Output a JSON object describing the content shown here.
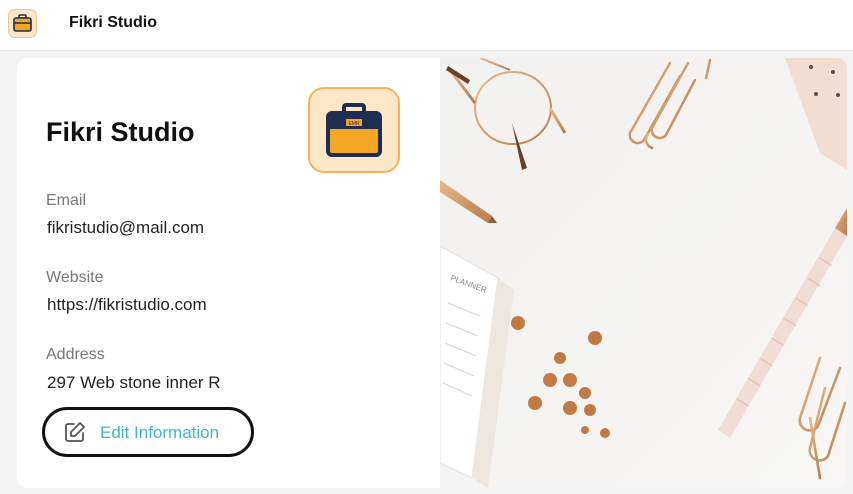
{
  "app": {
    "title": "Fikri Studio",
    "logo_icon": "briefcase-icon"
  },
  "profile": {
    "name": "Fikri Studio",
    "logo_icon": "briefcase-icon",
    "logo_text": "EMR",
    "fields": [
      {
        "label": "Email",
        "value": "fikristudio@mail.com"
      },
      {
        "label": "Website",
        "value": "https://fikristudio.com"
      },
      {
        "label": "Address",
        "value": "297 Web stone inner R"
      }
    ],
    "edit_button": {
      "label": "Edit Information",
      "icon": "edit-icon"
    }
  },
  "photo": {
    "planner_text": "PLANNER"
  },
  "colors": {
    "accent": "#3fb6c6",
    "logo_orange": "#f5a623",
    "logo_navy": "#1f2d4f"
  }
}
